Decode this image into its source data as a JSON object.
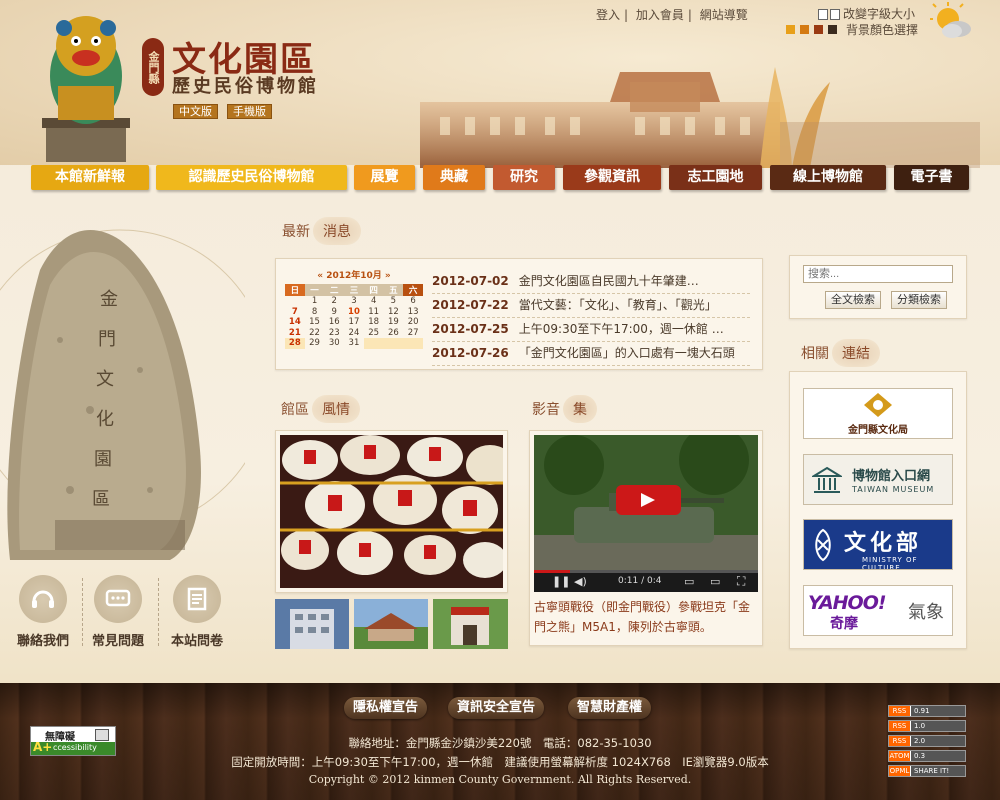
{
  "header": {
    "seal": "金門縣",
    "title": "文化園區",
    "subtitle": "歷史民俗博物館",
    "lang_chinese": "中文版",
    "lang_mobile": "手機版",
    "top_links": [
      "登入",
      "加入會員",
      "網站導覽"
    ],
    "font_size_label": "改變字級大小",
    "bg_color_label": "背景顏色選擇",
    "bg_swatches": [
      "#e8a01a",
      "#d47a12",
      "#9a3a12",
      "#3a2a1e"
    ]
  },
  "nav": [
    {
      "label": "本館新鮮報",
      "color": "#e6a812"
    },
    {
      "label": "認識歷史民俗博物館",
      "color": "#f0b81c"
    },
    {
      "label": "展覽",
      "color": "#f09a1e"
    },
    {
      "label": "典藏",
      "color": "#e07a1a"
    },
    {
      "label": "研究",
      "color": "#c25a30"
    },
    {
      "label": "參觀資訊",
      "color": "#9a3a1a"
    },
    {
      "label": "志工園地",
      "color": "#7a3018"
    },
    {
      "label": "線上博物館",
      "color": "#5a2a14"
    },
    {
      "label": "電子書",
      "color": "#3e2010"
    }
  ],
  "left_buttons": [
    "聯絡我們",
    "常見問題",
    "本站問卷"
  ],
  "news": {
    "head1": "最新",
    "head2": "消息",
    "calendar": {
      "title": "2012年10月",
      "weekdays": [
        "日",
        "一",
        "二",
        "三",
        "四",
        "五",
        "六"
      ],
      "weeks": [
        [
          "",
          "1",
          "2",
          "3",
          "4",
          "5",
          "6"
        ],
        [
          "7",
          "8",
          "9",
          "10",
          "11",
          "12",
          "13"
        ],
        [
          "14",
          "15",
          "16",
          "17",
          "18",
          "19",
          "20"
        ],
        [
          "21",
          "22",
          "23",
          "24",
          "25",
          "26",
          "27"
        ],
        [
          "28",
          "29",
          "30",
          "31",
          "",
          "",
          ""
        ]
      ]
    },
    "items": [
      {
        "date": "2012-07-02",
        "text": "金門文化園區自民國九十年肇建…"
      },
      {
        "date": "2012-07-22",
        "text": "當代文藝：「文化」、「教育」、「觀光」"
      },
      {
        "date": "2012-07-25",
        "text": "上午09:30至下午17:00，週一休館 …"
      },
      {
        "date": "2012-07-26",
        "text": "「金門文化園區」的入口處有一塊大石頭"
      }
    ]
  },
  "scenery": {
    "head1": "館區",
    "head2": "風情"
  },
  "video": {
    "head1": "影音",
    "head2": "集",
    "time": "0:11 / 0:4",
    "caption": "古寧頭戰役（即金門戰役）參戰坦克「金門之熊」M5A1，陳列於古寧頭。"
  },
  "search": {
    "placeholder": "搜索...",
    "full": "全文檢索",
    "category": "分類檢索"
  },
  "links": {
    "head1": "相關",
    "head2": "連結",
    "culture_bureau": "金門縣文化局",
    "museum_portal": "博物館入口網",
    "museum_portal_en": "TAIWAN MUSEUM",
    "moc": "文化部",
    "moc_en": "MINISTRY OF CULTURE",
    "yahoo": "YAHOO!",
    "yahoo_sub": "奇摩",
    "weather": "氣象"
  },
  "footer": {
    "buttons": [
      "隱私權宣告",
      "資訊安全宣告",
      "智慧財產權"
    ],
    "address": "聯絡地址：金門縣金沙鎮沙美220號　電話：082-35-1030",
    "hours": "固定開放時間：上午09:30至下午17:00，週一休館　建議使用螢幕解析度 1024X768　IE瀏覽器9.0版本",
    "copyright": "Copyright © 2012 kinmen County Government. All Rights Reserved.",
    "accessibility": "無障礙",
    "accessibility_sub": "ccessibility",
    "feeds": [
      {
        "a": "RSS",
        "b": "0.91"
      },
      {
        "a": "RSS",
        "b": "1.0"
      },
      {
        "a": "RSS",
        "b": "2.0"
      },
      {
        "a": "ATOM",
        "b": "0.3"
      },
      {
        "a": "OPML",
        "b": "SHARE IT!"
      }
    ]
  }
}
